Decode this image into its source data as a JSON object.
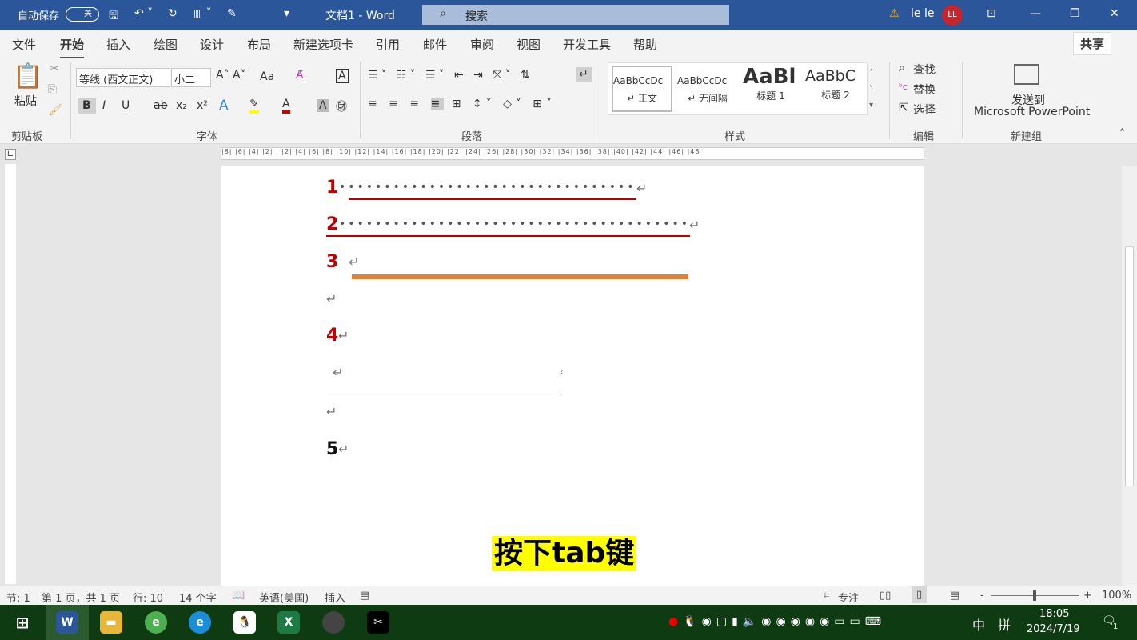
{
  "titlebar": {
    "autosave": "自动保存",
    "autosave_state": "关",
    "doc_title": "文档1  -  Word",
    "search_placeholder": "搜索",
    "user": "le le",
    "avatar": "LL"
  },
  "tabs": [
    "文件",
    "开始",
    "插入",
    "绘图",
    "设计",
    "布局",
    "新建选项卡",
    "引用",
    "邮件",
    "审阅",
    "视图",
    "开发工具",
    "帮助"
  ],
  "share": "共享",
  "ribbon": {
    "clipboard": {
      "paste": "粘贴",
      "label": "剪贴板"
    },
    "font": {
      "name": "等线 (西文正文)",
      "size": "小二",
      "label": "字体",
      "case": "Aa"
    },
    "paragraph": {
      "label": "段落"
    },
    "styles": {
      "items": [
        {
          "preview": "AaBbCcDc",
          "name": "↵ 正文"
        },
        {
          "preview": "AaBbCcDc",
          "name": "↵ 无间隔"
        },
        {
          "preview": "AaBl",
          "name": "标题 1"
        },
        {
          "preview": "AaBbC",
          "name": "标题 2"
        }
      ],
      "label": "样式"
    },
    "editing": {
      "find": "查找",
      "replace": "替换",
      "select": "选择",
      "label": "编辑"
    },
    "newgroup": {
      "send1": "发送到",
      "send2": "Microsoft PowerPoint",
      "label": "新建组"
    }
  },
  "ruler": "|8| |6| |4| |2| |  |2| |4| |6| |8| |10| |12| |14| |16| |18| |20| |22| |24| |26| |28| |30| |32| |34| |36| |38| |40| |42| |44| |46| |48",
  "document": {
    "lines": [
      "1",
      "2",
      "3",
      "4",
      "5"
    ],
    "return_mark": "↵",
    "caption": "按下tab键"
  },
  "status": {
    "section": "节: 1",
    "page": "第 1 页，共 1 页",
    "line": "行: 10",
    "words": "14 个字",
    "language": "英语(美国)",
    "mode": "插入",
    "focus": "专注",
    "zoom": "100%",
    "zoom_minus": "-",
    "zoom_plus": "+"
  },
  "taskbar": {
    "time": "18:05",
    "date": "2024/7/19",
    "ime": "中",
    "ime2": "拼",
    "notifications": "1"
  },
  "colors": {
    "title": "#2b579a",
    "red_number": "#c00000",
    "orange_line": "#e0813a",
    "caption_bg": "#ffff00",
    "taskbar": "#0e3b12"
  }
}
